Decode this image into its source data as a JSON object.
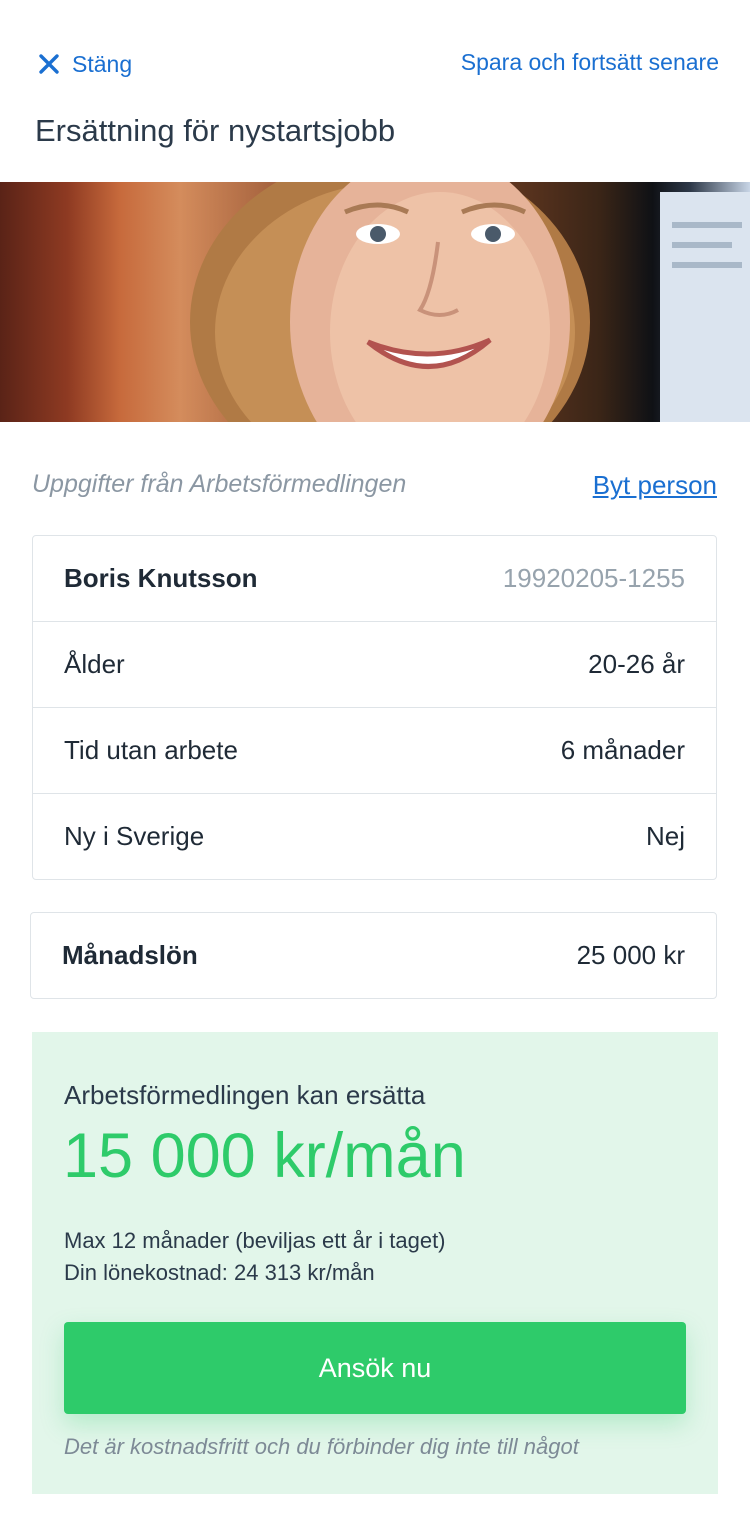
{
  "header": {
    "close_label": "Stäng",
    "save_label": "Spara och fortsätt senare",
    "title": "Ersättning för nystartsjobb"
  },
  "info": {
    "source_label": "Uppgifter från Arbetsförmedlingen",
    "switch_label": "Byt person"
  },
  "person": {
    "name": "Boris Knutsson",
    "id_number": "19920205-1255",
    "rows": [
      {
        "label": "Ålder",
        "value": "20-26 år"
      },
      {
        "label": "Tid utan arbete",
        "value": "6 månader"
      },
      {
        "label": "Ny i Sverige",
        "value": "Nej"
      }
    ]
  },
  "salary": {
    "label": "Månadslön",
    "value": "25 000 kr"
  },
  "result": {
    "lead": "Arbetsförmedlingen kan ersätta",
    "amount": "15 000 kr/mån",
    "note_max": "Max 12 månader (beviljas ett år i taget)",
    "note_cost": "Din lönekostnad: 24 313 kr/mån",
    "apply_label": "Ansök nu",
    "disclaimer": "Det är kostnadsfritt och du förbinder dig inte till något"
  },
  "colors": {
    "link": "#1a6fd1",
    "accent_green": "#2ecb6a",
    "result_bg": "#e2f6ea"
  },
  "icons": {
    "close": "close-icon"
  }
}
